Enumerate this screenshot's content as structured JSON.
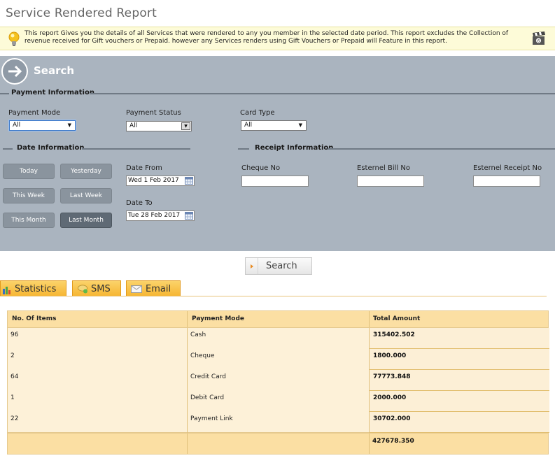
{
  "page": {
    "title": "Service Rendered Report",
    "info_text": "This report Gives you the details of all Services that were rendered to any you member in the selected date period. This report excludes the Collection of revenue received for Gift vouchers or Prepaid. however any Services renders using Gift Vouchers or Prepaid will Feature in this report."
  },
  "search_panel": {
    "heading": "Search",
    "payment_section": "Payment Information",
    "payment_mode_label": "Payment Mode",
    "payment_mode_value": "All",
    "payment_status_label": "Payment Status",
    "payment_status_value": "All",
    "card_type_label": "Card Type",
    "card_type_value": "All",
    "date_section": "Date Information",
    "receipt_section": "Receipt Information",
    "quick_buttons": {
      "today": "Today",
      "yesterday": "Yesterday",
      "this_week": "This Week",
      "last_week": "Last Week",
      "this_month": "This Month",
      "last_month": "Last Month"
    },
    "active_quick_button": "Last Month",
    "date_from_label": "Date From",
    "date_from_value": "Wed 1 Feb 2017",
    "date_to_label": "Date To",
    "date_to_value": "Tue 28 Feb 2017",
    "cheque_no_label": "Cheque No",
    "external_bill_label": "Esternel Bill No",
    "external_receipt_label": "Esternel Receipt No"
  },
  "search_button_label": "Search",
  "tabs": [
    {
      "label": "Statistics",
      "icon": "bar-chart-icon"
    },
    {
      "label": "SMS",
      "icon": "sms-icon"
    },
    {
      "label": "Email",
      "icon": "envelope-icon"
    }
  ],
  "table": {
    "headers": [
      "No. Of Items",
      "Payment Mode",
      "Total Amount"
    ],
    "rows": [
      {
        "items": "96",
        "mode": "Cash",
        "amount": "315402.502"
      },
      {
        "items": "2",
        "mode": "Cheque",
        "amount": "1800.000"
      },
      {
        "items": "64",
        "mode": "Credit Card",
        "amount": "77773.848"
      },
      {
        "items": "1",
        "mode": "Debit Card",
        "amount": "2000.000"
      },
      {
        "items": "22",
        "mode": "Payment Link",
        "amount": "30702.000"
      }
    ],
    "total": "427678.350"
  },
  "colors": {
    "panel": "#aab4bf",
    "tab_gold": "#f6b531",
    "table_header": "#fbdfa3",
    "table_body": "#fdf1d8"
  }
}
